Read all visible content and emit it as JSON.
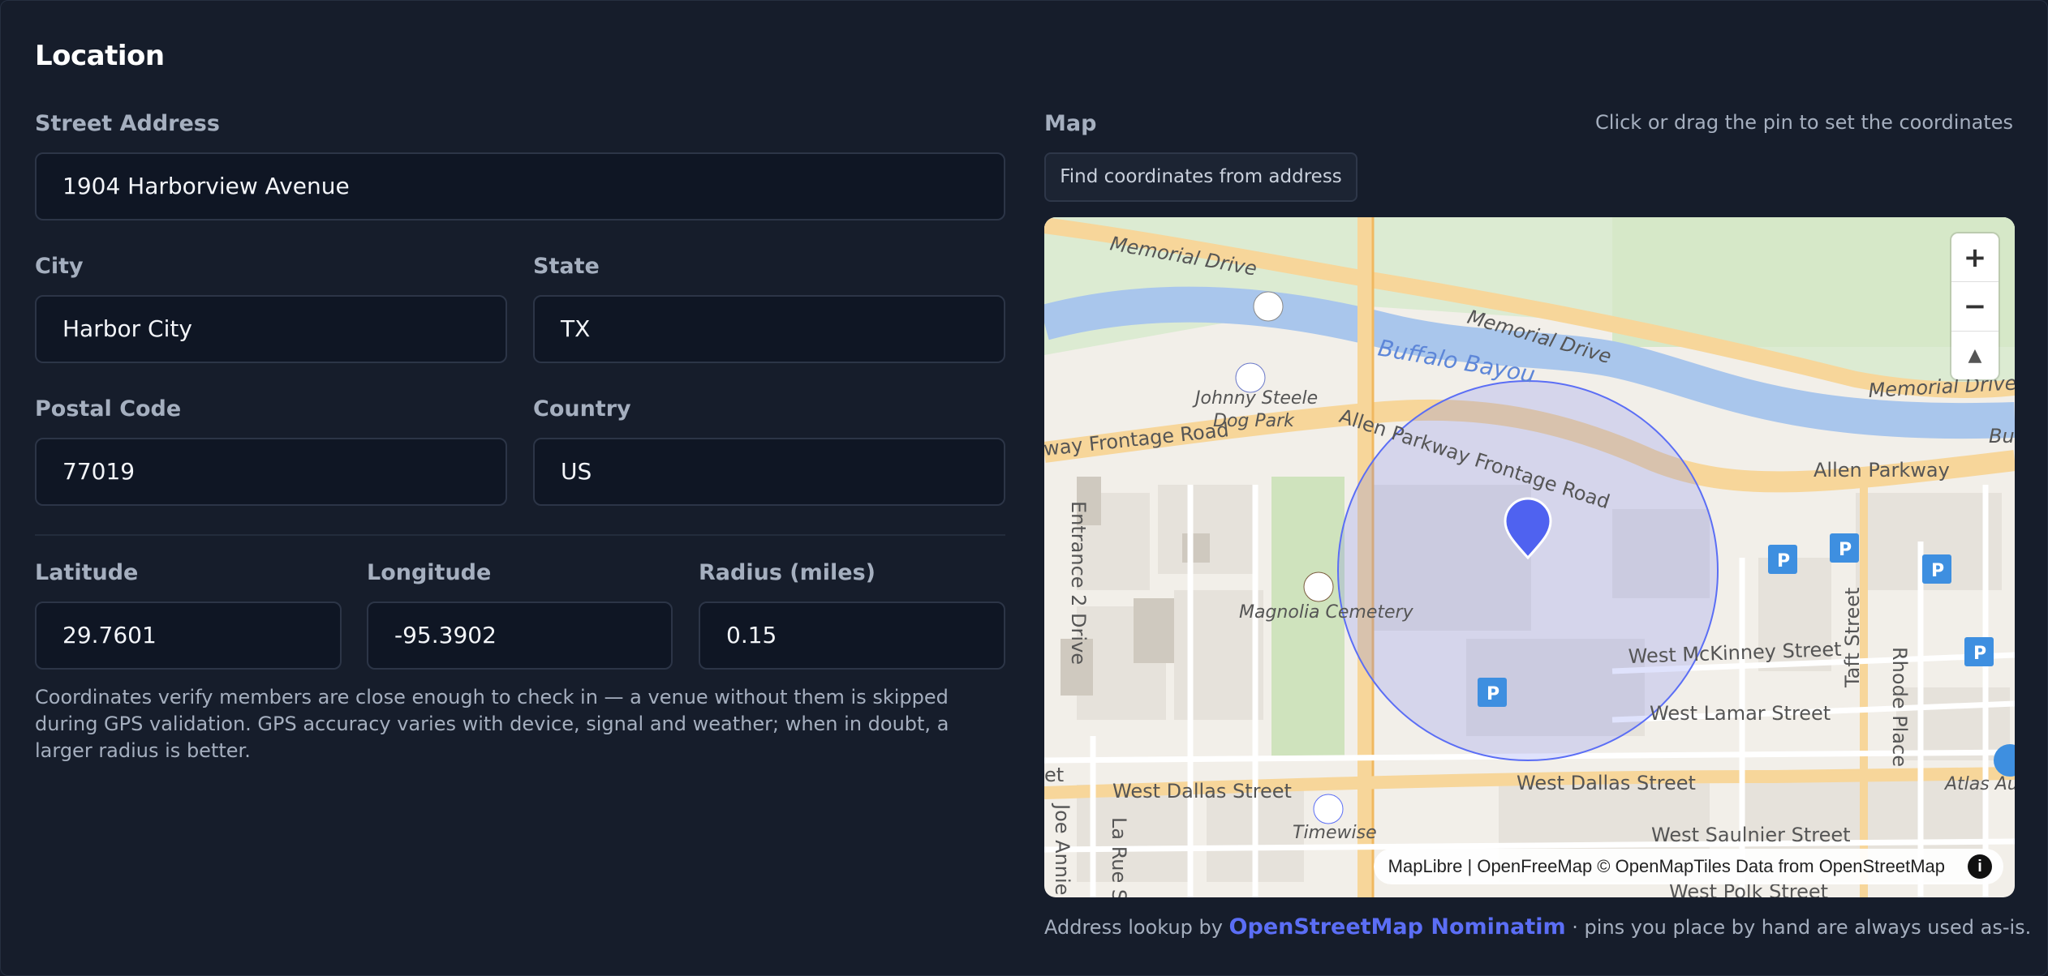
{
  "section_title": "Location",
  "address": {
    "street_label": "Street Address",
    "street_value": "1904 Harborview Avenue",
    "city_label": "City",
    "city_value": "Harbor City",
    "state_label": "State",
    "state_value": "TX",
    "postal_label": "Postal Code",
    "postal_value": "77019",
    "country_label": "Country",
    "country_value": "US"
  },
  "coords": {
    "lat_label": "Latitude",
    "lat_value": "29.7601",
    "lng_label": "Longitude",
    "lng_value": "-95.3902",
    "radius_label": "Radius (miles)",
    "radius_value": "0.15",
    "help_text": "Coordinates verify members are close enough to check in — a venue without them is skipped during GPS validation. GPS accuracy varies with device, signal and weather; when in doubt, a larger radius is better."
  },
  "map": {
    "label": "Map",
    "hint": "Click or drag the pin to set the coordinates",
    "find_button": "Find coordinates from address",
    "zoom_in": "+",
    "zoom_out": "−",
    "compass": "▲",
    "attribution": {
      "maplibre": "MapLibre",
      "sep": " | ",
      "openfreemap": "OpenFreeMap",
      "omt": " © OpenMapTiles",
      "data_from": " Data from ",
      "osm": "OpenStreetMap",
      "info": "i"
    },
    "labels": {
      "memorial_drive_1": "Memorial Drive",
      "memorial_drive_2": "Memorial Drive",
      "memorial_drive_3": "Memorial Drive",
      "buffalo_bayou": "Buffalo Bayou",
      "buffa": "Buffa",
      "johnny_steele_1": "Johnny Steele",
      "johnny_steele_2": "Dog Park",
      "frontage_left": "way Frontage Road",
      "frontage_right": "Allen Parkway Frontage Road",
      "allen_parkway": "Allen Parkway",
      "entrance": "Entrance 2 Drive",
      "magnolia": "Magnolia Cemetery",
      "mckinney": "West McKinney Street",
      "lamar": "West Lamar Street",
      "dallas_1": "West Dallas Street",
      "dallas_2": "West Dallas Street",
      "taft": "Taft Street",
      "rhode": "Rhode Place",
      "atlas": "Atlas Auto",
      "timewise": "Timewise",
      "saulnier": "West Saulnier Street",
      "polk": "West Polk Street",
      "joe_annie": "Joe Annie",
      "la_rue": "La Rue S",
      "et": "et",
      "parking": "P"
    },
    "accent_color": "#4f62f0",
    "radius_fill": "#6f7cf2"
  },
  "footer": {
    "prefix": "Address lookup by ",
    "link": "OpenStreetMap Nominatim",
    "suffix": " · pins you place by hand are always used as-is."
  }
}
